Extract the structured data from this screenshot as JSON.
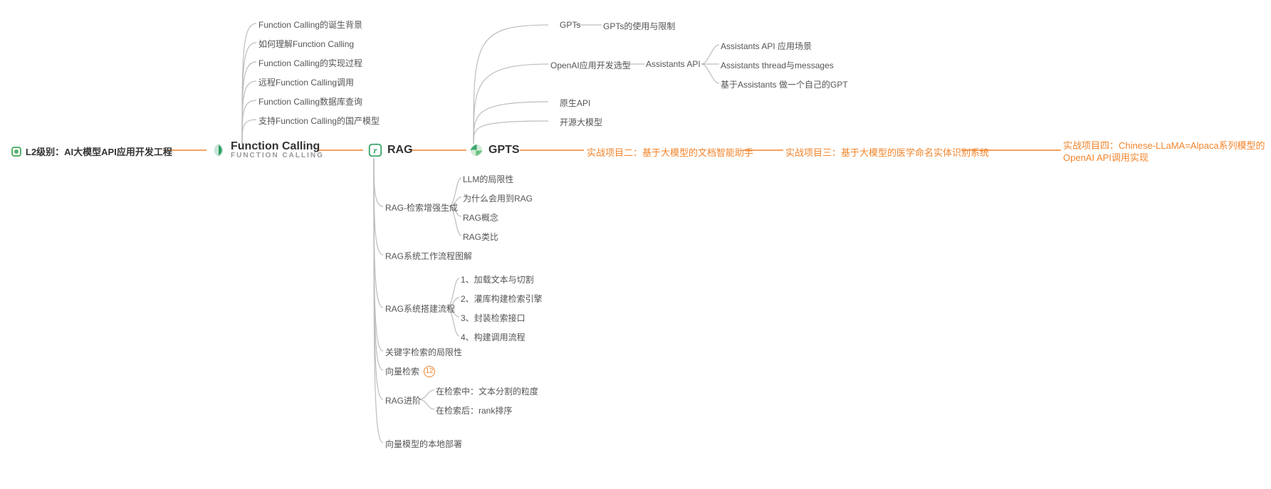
{
  "root": {
    "label": "L2级别：AI大模型API应用开发工程"
  },
  "hubs": {
    "fc": {
      "label": "Function Calling",
      "sub": "FUNCTION CALLING"
    },
    "rag": {
      "label": "RAG"
    },
    "gpts": {
      "label": "GPTS"
    }
  },
  "fc_leaves": [
    "Function Calling的诞生背景",
    "如何理解Function Calling",
    "Function Calling的实现过程",
    "远程Function Calling调用",
    "Function Calling数据库查询",
    "支持Function Calling的国产模型"
  ],
  "gpts_top": {
    "branches": [
      {
        "label": "GPTs",
        "children": [
          "GPTs的使用与限制"
        ]
      },
      {
        "label": "OpenAI应用开发选型",
        "children": []
      },
      {
        "label": "原生API",
        "children": []
      },
      {
        "label": "开源大模型",
        "children": []
      }
    ],
    "assistants": {
      "label": "Assistants API",
      "children": [
        "Assistants API 应用场景",
        "Assistants thread与messages",
        "基于Assistants 做一个自己的GPT"
      ]
    }
  },
  "rag_bottom": {
    "b1": {
      "label": "RAG-检索增强生成",
      "children": [
        "LLM的局限性",
        "为什么会用到RAG",
        "RAG概念",
        "RAG类比"
      ]
    },
    "b2": {
      "label": "RAG系统工作流程图解"
    },
    "b3": {
      "label": "RAG系统搭建流程",
      "children": [
        "1、加载文本与切割",
        "2、灌库构建检索引擎",
        "3、封装检索接口",
        "4、构建调用流程"
      ]
    },
    "b4": {
      "label": "关键字检索的局限性"
    },
    "b5": {
      "label": "向量检索",
      "badge": "12"
    },
    "b6": {
      "label": "RAG进阶",
      "children": [
        "在检索中：文本分割的粒度",
        "在检索后：rank排序"
      ]
    },
    "b7": {
      "label": "向量模型的本地部署"
    }
  },
  "projects": {
    "p2": "实战项目二：基于大模型的文档智能助手",
    "p3": "实战项目三：基于大模型的医学命名实体识别系统",
    "p4_line1": "实战项目四：Chinese-LLaMA=Alpaca系列模型的",
    "p4_line2": "OpenAI API调用实现"
  }
}
